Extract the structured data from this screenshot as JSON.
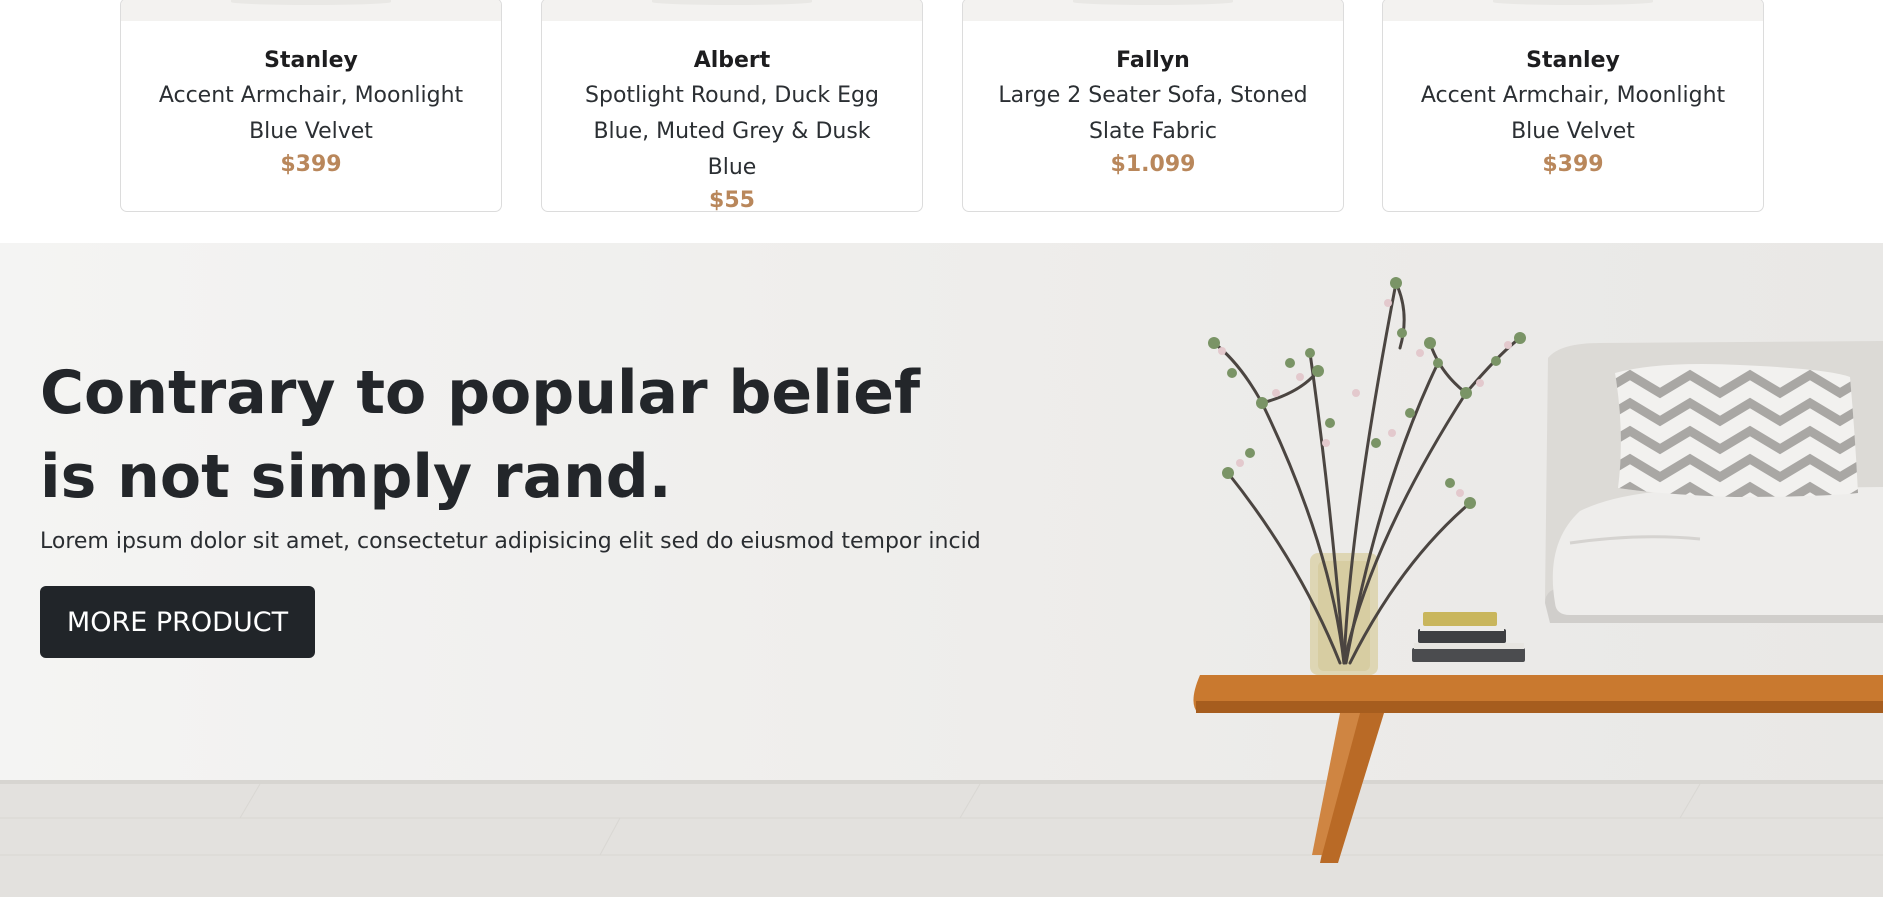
{
  "products": [
    {
      "name": "Stanley",
      "description": "Accent Armchair, Moonlight Blue Velvet",
      "price": "$399"
    },
    {
      "name": "Albert",
      "description": "Spotlight Round, Duck Egg Blue, Muted Grey & Dusk Blue",
      "price": "$55"
    },
    {
      "name": "Fallyn",
      "description": "Large 2 Seater Sofa, Stoned Slate Fabric",
      "price": "$1.099"
    },
    {
      "name": "Stanley",
      "description": "Accent Armchair, Moonlight Blue Velvet",
      "price": "$399"
    }
  ],
  "hero": {
    "title": "Contrary to popular belief is not simply rand.",
    "text": "Lorem ipsum dolor sit amet, consectetur adipisicing elit sed do eiusmod tempor incid",
    "button_label": "MORE PRODUCT",
    "image_icon": "living-room-photo"
  },
  "colors": {
    "price": "#b9875b",
    "button_bg": "#212529",
    "heading": "#23262a"
  }
}
